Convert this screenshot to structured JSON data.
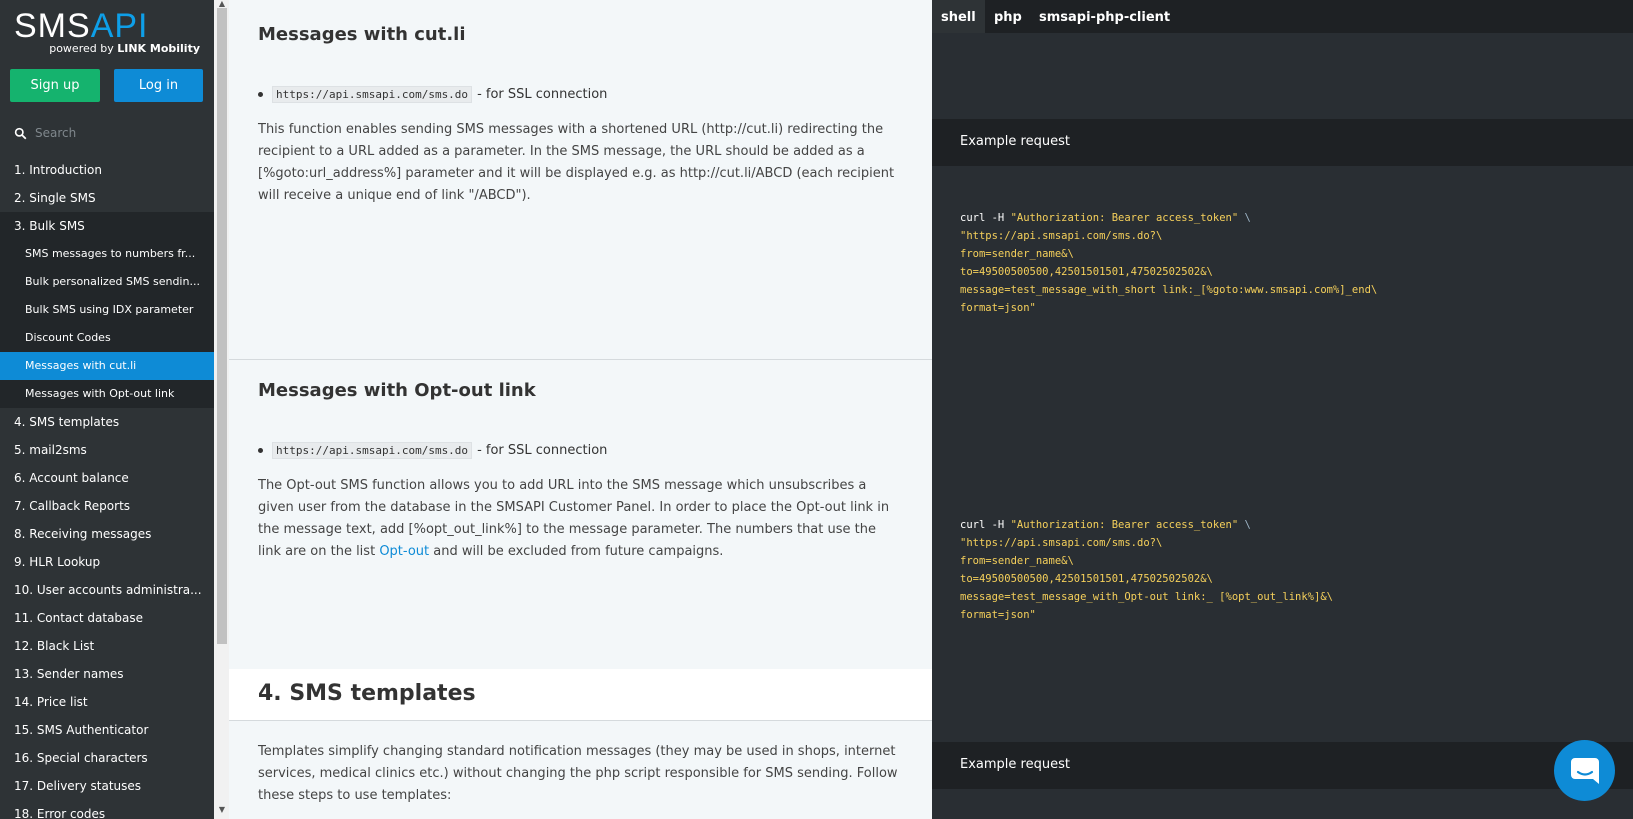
{
  "sidebar": {
    "logo": {
      "sms": "SMS",
      "api": "API",
      "powered_prefix": "powered by",
      "powered_brand": "LINK Mobility"
    },
    "signup_label": "Sign up",
    "login_label": "Log in",
    "search_placeholder": "Search",
    "toc": [
      {
        "label": "1. Introduction",
        "kind": "top"
      },
      {
        "label": "2. Single SMS",
        "kind": "top"
      },
      {
        "label": "3. Bulk SMS",
        "kind": "parent-active"
      },
      {
        "label": "SMS messages to numbers fr...",
        "kind": "sub"
      },
      {
        "label": "Bulk personalized SMS sendin...",
        "kind": "sub"
      },
      {
        "label": "Bulk SMS using IDX parameter",
        "kind": "sub"
      },
      {
        "label": "Discount Codes",
        "kind": "sub"
      },
      {
        "label": "Messages with cut.li",
        "kind": "active"
      },
      {
        "label": "Messages with Opt-out link",
        "kind": "sub"
      },
      {
        "label": "4. SMS templates",
        "kind": "top"
      },
      {
        "label": "5. mail2sms",
        "kind": "top"
      },
      {
        "label": "6. Account balance",
        "kind": "top"
      },
      {
        "label": "7. Callback Reports",
        "kind": "top"
      },
      {
        "label": "8. Receiving messages",
        "kind": "top"
      },
      {
        "label": "9. HLR Lookup",
        "kind": "top"
      },
      {
        "label": "10. User accounts administra...",
        "kind": "top"
      },
      {
        "label": "11. Contact database",
        "kind": "top"
      },
      {
        "label": "12. Black List",
        "kind": "top"
      },
      {
        "label": "13. Sender names",
        "kind": "top"
      },
      {
        "label": "14. Price list",
        "kind": "top"
      },
      {
        "label": "15. SMS Authenticator",
        "kind": "top"
      },
      {
        "label": "16. Special characters",
        "kind": "top"
      },
      {
        "label": "17. Delivery statuses",
        "kind": "top"
      },
      {
        "label": "18. Error codes",
        "kind": "top"
      }
    ]
  },
  "content": {
    "cutli": {
      "title": "Messages with cut.li",
      "endpoint": "https://api.smsapi.com/sms.do",
      "endpoint_note": "- for SSL connection",
      "description": "This function enables sending SMS messages with a shortened URL (http://cut.li) redirecting the recipient to a URL added as a parameter. In the SMS message, the URL should be added as a [%goto:url_address%] parameter and it will be displayed e.g. as http://cut.li/ABCD (each recipient will receive a unique end of link \"/ABCD\")."
    },
    "optout": {
      "title": "Messages with Opt-out link",
      "endpoint": "https://api.smsapi.com/sms.do",
      "endpoint_note": "- for SSL connection",
      "description_start": "The Opt-out SMS function allows you to add URL into the SMS message which unsubscribes a given user from the database in the SMSAPI Customer Panel. In order to place the Opt-out link in the message text, add [%opt_out_link%] to the message parameter. The numbers that use the link are on the list",
      "link_text": "Opt-out",
      "description_end": "and will be excluded from future campaigns."
    },
    "templates": {
      "title": "4. SMS templates",
      "description": "Templates simplify changing standard notification messages (they may be used in shops, internet services, medical clinics etc.) without changing the php script responsible for SMS sending. Follow these steps to use templates:"
    }
  },
  "codepane": {
    "tabs": [
      {
        "label": "shell",
        "active": true
      },
      {
        "label": "php",
        "active": false
      },
      {
        "label": "smsapi-php-client",
        "active": false
      }
    ],
    "example_label": "Example request",
    "code_cutli": {
      "l1a": "curl -H ",
      "l1b": "\"Authorization: Bearer access_token\"",
      "l1c": " \\",
      "l2": "\"https://api.smsapi.com/sms.do?\\",
      "l3": "from=sender_name&\\",
      "l4": "to=49500500500,42501501501,47502502502&\\",
      "l5": "message=test_message_with_short link:_[%goto:www.smsapi.com%]_end\\",
      "l6": "format=json\""
    },
    "code_optout": {
      "l1a": "curl -H ",
      "l1b": "\"Authorization: Bearer access_token\"",
      "l1c": " \\",
      "l2": "\"https://api.smsapi.com/sms.do?\\",
      "l3": "from=sender_name&\\",
      "l4": "to=49500500500,42501501501,47502502502&\\",
      "l5": "message=test_message_with_Opt-out link:_ [%opt_out_link%]&\\",
      "l6": "format=json\""
    }
  },
  "colors": {
    "accent": "#0e8bd6",
    "signup": "#15b36e",
    "sidebar_bg": "#2e3336",
    "code_bg": "#292e33",
    "string": "#f5d05b"
  }
}
